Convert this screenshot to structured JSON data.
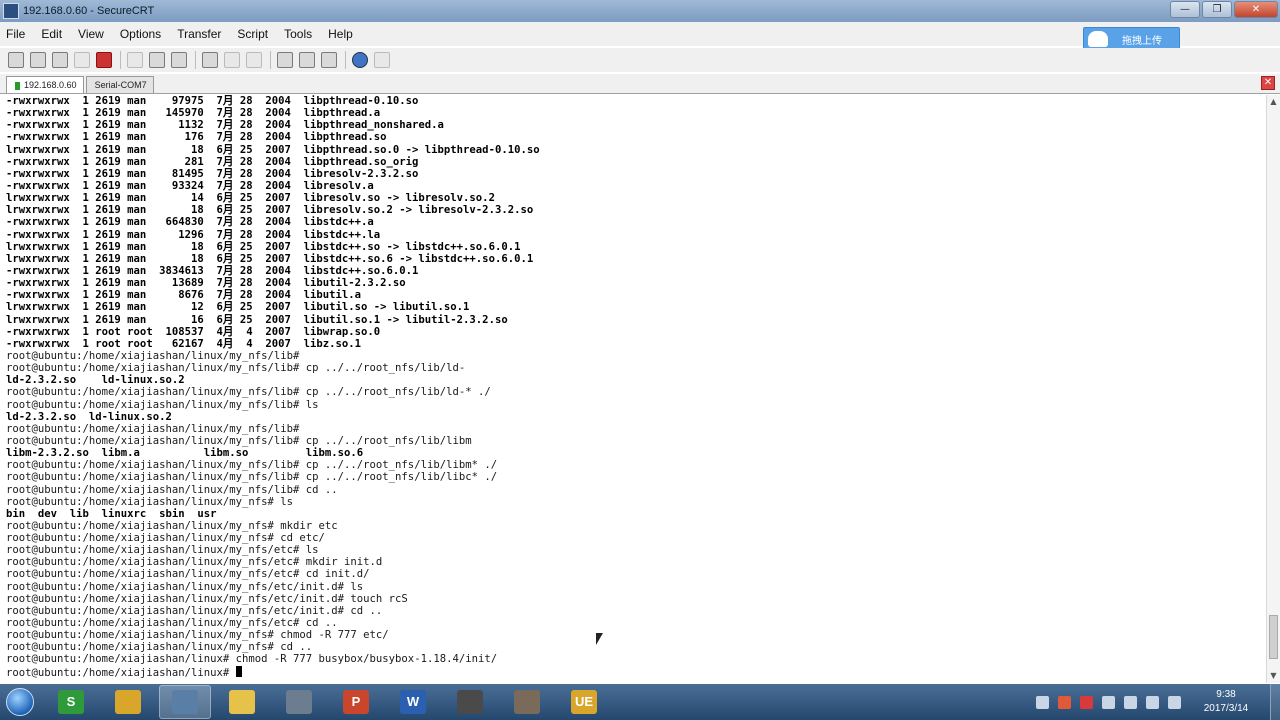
{
  "window": {
    "title": "192.168.0.60 - SecureCRT",
    "buttons": {
      "minimize": "—",
      "maximize": "❐",
      "close": "✕"
    }
  },
  "menu": {
    "items": [
      "File",
      "Edit",
      "View",
      "Options",
      "Transfer",
      "Script",
      "Tools",
      "Help"
    ],
    "cloud_button": "拖拽上传"
  },
  "tabs": {
    "items": [
      "192.168.0.60",
      "Serial-COM7"
    ],
    "close": "✕"
  },
  "terminal": {
    "lines": [
      "-rwxrwxrwx  1 2619 man    97975  7月 28  2004  libpthread-0.10.so",
      "-rwxrwxrwx  1 2619 man   145970  7月 28  2004  libpthread.a",
      "-rwxrwxrwx  1 2619 man     1132  7月 28  2004  libpthread_nonshared.a",
      "-rwxrwxrwx  1 2619 man      176  7月 28  2004  libpthread.so",
      "lrwxrwxrwx  1 2619 man       18  6月 25  2007  libpthread.so.0 -> libpthread-0.10.so",
      "-rwxrwxrwx  1 2619 man      281  7月 28  2004  libpthread.so_orig",
      "-rwxrwxrwx  1 2619 man    81495  7月 28  2004  libresolv-2.3.2.so",
      "-rwxrwxrwx  1 2619 man    93324  7月 28  2004  libresolv.a",
      "lrwxrwxrwx  1 2619 man       14  6月 25  2007  libresolv.so -> libresolv.so.2",
      "lrwxrwxrwx  1 2619 man       18  6月 25  2007  libresolv.so.2 -> libresolv-2.3.2.so",
      "-rwxrwxrwx  1 2619 man   664830  7月 28  2004  libstdc++.a",
      "-rwxrwxrwx  1 2619 man     1296  7月 28  2004  libstdc++.la",
      "lrwxrwxrwx  1 2619 man       18  6月 25  2007  libstdc++.so -> libstdc++.so.6.0.1",
      "lrwxrwxrwx  1 2619 man       18  6月 25  2007  libstdc++.so.6 -> libstdc++.so.6.0.1",
      "-rwxrwxrwx  1 2619 man  3834613  7月 28  2004  libstdc++.so.6.0.1",
      "-rwxrwxrwx  1 2619 man    13689  7月 28  2004  libutil-2.3.2.so",
      "-rwxrwxrwx  1 2619 man     8676  7月 28  2004  libutil.a",
      "lrwxrwxrwx  1 2619 man       12  6月 25  2007  libutil.so -> libutil.so.1",
      "lrwxrwxrwx  1 2619 man       16  6月 25  2007  libutil.so.1 -> libutil-2.3.2.so",
      "-rwxrwxrwx  1 root root  108537  4月  4  2007  libwrap.so.0",
      "-rwxrwxrwx  1 root root   62167  4月  4  2007  libz.so.1",
      "root@ubuntu:/home/xiajiashan/linux/my_nfs/lib#",
      "root@ubuntu:/home/xiajiashan/linux/my_nfs/lib# cp ../../root_nfs/lib/ld-",
      "ld-2.3.2.so    ld-linux.so.2",
      "root@ubuntu:/home/xiajiashan/linux/my_nfs/lib# cp ../../root_nfs/lib/ld-* ./",
      "root@ubuntu:/home/xiajiashan/linux/my_nfs/lib# ls",
      "ld-2.3.2.so  ld-linux.so.2",
      "root@ubuntu:/home/xiajiashan/linux/my_nfs/lib#",
      "root@ubuntu:/home/xiajiashan/linux/my_nfs/lib# cp ../../root_nfs/lib/libm",
      "libm-2.3.2.so  libm.a          libm.so         libm.so.6",
      "root@ubuntu:/home/xiajiashan/linux/my_nfs/lib# cp ../../root_nfs/lib/libm* ./",
      "root@ubuntu:/home/xiajiashan/linux/my_nfs/lib# cp ../../root_nfs/lib/libc* ./",
      "root@ubuntu:/home/xiajiashan/linux/my_nfs/lib# cd ..",
      "root@ubuntu:/home/xiajiashan/linux/my_nfs# ls",
      "bin  dev  lib  linuxrc  sbin  usr",
      "root@ubuntu:/home/xiajiashan/linux/my_nfs# mkdir etc",
      "root@ubuntu:/home/xiajiashan/linux/my_nfs# cd etc/",
      "root@ubuntu:/home/xiajiashan/linux/my_nfs/etc# ls",
      "root@ubuntu:/home/xiajiashan/linux/my_nfs/etc# mkdir init.d",
      "root@ubuntu:/home/xiajiashan/linux/my_nfs/etc# cd init.d/",
      "root@ubuntu:/home/xiajiashan/linux/my_nfs/etc/init.d# ls",
      "root@ubuntu:/home/xiajiashan/linux/my_nfs/etc/init.d# touch rcS",
      "root@ubuntu:/home/xiajiashan/linux/my_nfs/etc/init.d# cd ..",
      "root@ubuntu:/home/xiajiashan/linux/my_nfs/etc# cd ..",
      "root@ubuntu:/home/xiajiashan/linux/my_nfs# chmod -R 777 etc/",
      "root@ubuntu:/home/xiajiashan/linux/my_nfs# cd ..",
      "root@ubuntu:/home/xiajiashan/linux# chmod -R 777 busybox/busybox-1.18.4/init/",
      "root@ubuntu:/home/xiajiashan/linux# "
    ],
    "bold_lines": [
      0,
      1,
      2,
      3,
      4,
      5,
      6,
      7,
      8,
      9,
      10,
      11,
      12,
      13,
      14,
      15,
      16,
      17,
      18,
      19,
      20,
      23,
      26,
      29,
      34
    ]
  },
  "taskbar": {
    "apps": [
      {
        "name": "360-browser-icon",
        "glyph": "S",
        "color": "#2f9a3a"
      },
      {
        "name": "file-manager-icon",
        "glyph": "",
        "color": "#d9a62c"
      },
      {
        "name": "securecrt-icon",
        "glyph": "",
        "color": "#5a7fa6",
        "active": true
      },
      {
        "name": "folder-icon",
        "glyph": "",
        "color": "#e6c24a"
      },
      {
        "name": "network-icon",
        "glyph": "",
        "color": "#6b7d8f"
      },
      {
        "name": "powerpoint-icon",
        "glyph": "P",
        "color": "#c9452b"
      },
      {
        "name": "word-icon",
        "glyph": "W",
        "color": "#2b5fb0"
      },
      {
        "name": "virtualbox-icon",
        "glyph": "",
        "color": "#4a4a4a"
      },
      {
        "name": "tool-icon",
        "glyph": "",
        "color": "#7a6a5a"
      },
      {
        "name": "ultraedit-icon",
        "glyph": "UE",
        "color": "#d9a62c"
      }
    ],
    "clock": {
      "time": "9:38",
      "date": "2017/3/14"
    }
  }
}
